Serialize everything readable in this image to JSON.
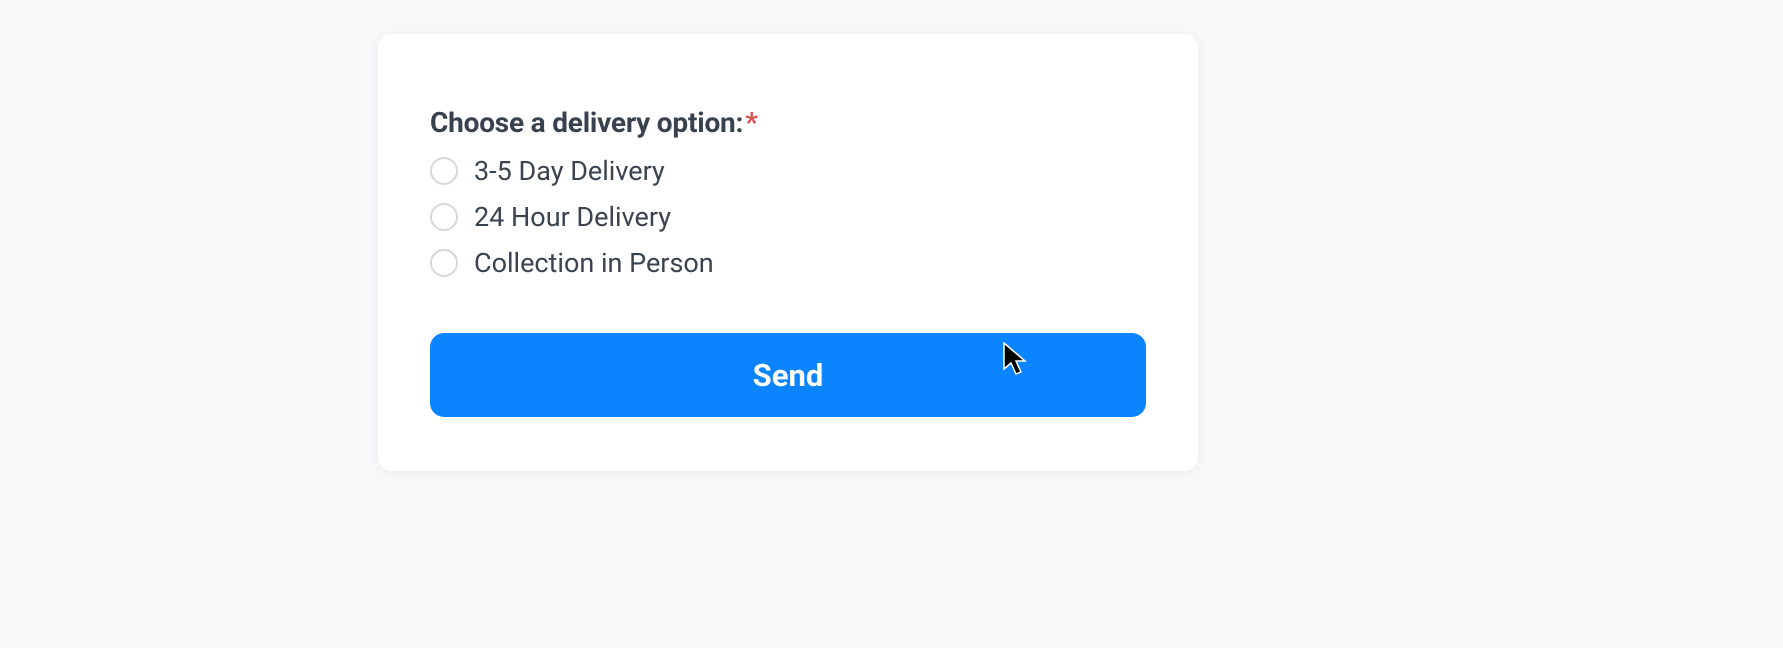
{
  "form": {
    "label": "Choose a delivery option:",
    "required_marker": "*",
    "options": [
      {
        "label": "3-5 Day Delivery"
      },
      {
        "label": "24 Hour Delivery"
      },
      {
        "label": "Collection in Person"
      }
    ],
    "submit_label": "Send"
  }
}
